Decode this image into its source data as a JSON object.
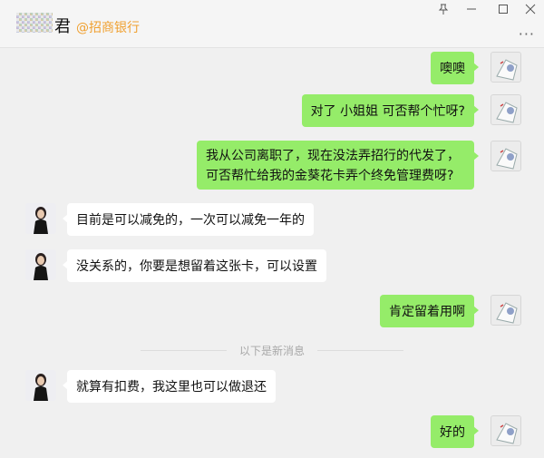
{
  "header": {
    "contact_name": "君",
    "contact_org": "@招商银行",
    "more_label": "···"
  },
  "window_controls": {
    "pin": "⊼",
    "minimize": "—",
    "maximize": "☐",
    "close": "✕"
  },
  "messages": [
    {
      "sender": "self",
      "text": "噢噢"
    },
    {
      "sender": "self",
      "text": "对了 小姐姐 可否帮个忙呀?"
    },
    {
      "sender": "self",
      "text": "我从公司离职了，现在没法弄招行的代发了，可否帮忙给我的金葵花卡弄个终免管理费呀?"
    },
    {
      "sender": "agent",
      "text": "目前是可以减免的，一次可以减免一年的"
    },
    {
      "sender": "agent",
      "text": "没关系的，你要是想留着这张卡，可以设置"
    },
    {
      "sender": "self",
      "text": "肯定留着用啊"
    },
    {
      "sender": "agent",
      "text": "就算有扣费，我这里也可以做退还"
    },
    {
      "sender": "self",
      "text": "好的"
    }
  ],
  "new_messages_divider": "以下是新消息",
  "colors": {
    "self_bubble": "#95ec69",
    "agent_bubble": "#ffffff",
    "org_label": "#f0a030",
    "background": "#f0f0f0"
  },
  "icons": {
    "self_avatar": "cartoon-avatar-icon",
    "agent_avatar": "woman-photo-avatar-icon"
  }
}
